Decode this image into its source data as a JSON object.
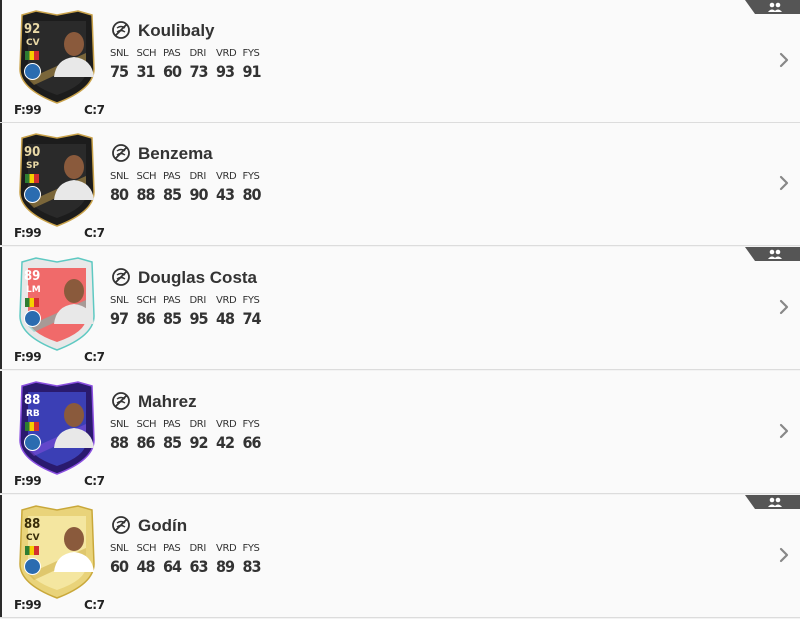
{
  "players": [
    {
      "name": "Koulibaly",
      "rating": "92",
      "position": "CV",
      "fitness": "F:99",
      "contracts": "C:7",
      "has_badge": true,
      "stats": [
        {
          "label": "SNL",
          "value": "75"
        },
        {
          "label": "SCH",
          "value": "31"
        },
        {
          "label": "PAS",
          "value": "60"
        },
        {
          "label": "DRI",
          "value": "73"
        },
        {
          "label": "VRD",
          "value": "93"
        },
        {
          "label": "FYS",
          "value": "91"
        }
      ],
      "card_style": "totw-black"
    },
    {
      "name": "Benzema",
      "rating": "90",
      "position": "SP",
      "fitness": "F:99",
      "contracts": "C:7",
      "has_badge": false,
      "stats": [
        {
          "label": "SNL",
          "value": "80"
        },
        {
          "label": "SCH",
          "value": "88"
        },
        {
          "label": "PAS",
          "value": "85"
        },
        {
          "label": "DRI",
          "value": "90"
        },
        {
          "label": "VRD",
          "value": "43"
        },
        {
          "label": "FYS",
          "value": "80"
        }
      ],
      "card_style": "totw-black"
    },
    {
      "name": "Douglas Costa",
      "rating": "89",
      "position": "LM",
      "fitness": "F:99",
      "contracts": "C:7",
      "has_badge": true,
      "stats": [
        {
          "label": "SNL",
          "value": "97"
        },
        {
          "label": "SCH",
          "value": "86"
        },
        {
          "label": "PAS",
          "value": "85"
        },
        {
          "label": "DRI",
          "value": "95"
        },
        {
          "label": "VRD",
          "value": "48"
        },
        {
          "label": "FYS",
          "value": "74"
        }
      ],
      "card_style": "summer-heat"
    },
    {
      "name": "Mahrez",
      "rating": "88",
      "position": "RB",
      "fitness": "F:99",
      "contracts": "C:7",
      "has_badge": false,
      "stats": [
        {
          "label": "SNL",
          "value": "88"
        },
        {
          "label": "SCH",
          "value": "86"
        },
        {
          "label": "PAS",
          "value": "85"
        },
        {
          "label": "DRI",
          "value": "92"
        },
        {
          "label": "VRD",
          "value": "42"
        },
        {
          "label": "FYS",
          "value": "66"
        }
      ],
      "card_style": "future-stars"
    },
    {
      "name": "Godín",
      "rating": "88",
      "position": "CV",
      "fitness": "F:99",
      "contracts": "C:7",
      "has_badge": true,
      "stats": [
        {
          "label": "SNL",
          "value": "60"
        },
        {
          "label": "SCH",
          "value": "48"
        },
        {
          "label": "PAS",
          "value": "64"
        },
        {
          "label": "DRI",
          "value": "63"
        },
        {
          "label": "VRD",
          "value": "89"
        },
        {
          "label": "FYS",
          "value": "83"
        }
      ],
      "card_style": "gold"
    }
  ],
  "icons": {
    "chemistry": "no-chemistry-icon",
    "chevron": "chevron-right-icon",
    "badge": "group-icon"
  },
  "colors": {
    "text": "#333333",
    "row_bg": "#fafafa",
    "divider": "#dcdcdc",
    "chevron": "#888888",
    "badge_bg": "#555555"
  }
}
